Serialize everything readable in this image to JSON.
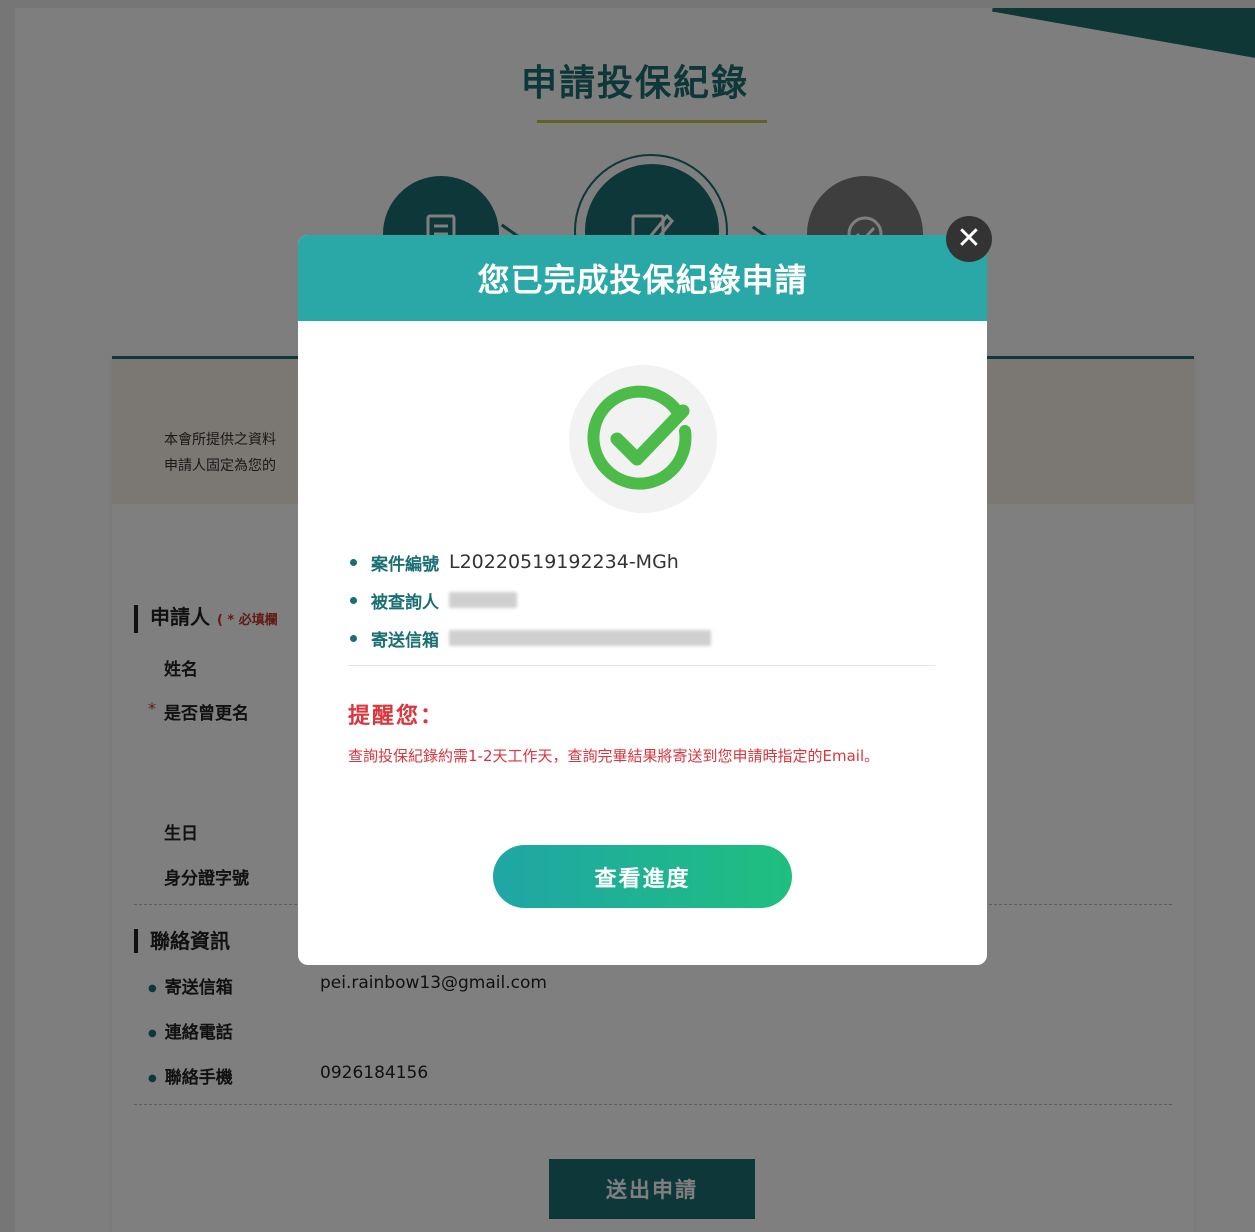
{
  "page": {
    "title": "申請投保紀錄"
  },
  "steps": [
    {
      "icon": "document-icon",
      "state": "done"
    },
    {
      "icon": "edit-icon",
      "state": "current"
    },
    {
      "icon": "check-circle-icon",
      "state": "pending"
    }
  ],
  "form": {
    "notice_lines": [
      "本會所提供之資料",
      "申請人固定為您的"
    ],
    "applicant_section": {
      "title": "申請人",
      "required_note": "( * 必填欄",
      "fields": [
        {
          "label": "姓名",
          "required": false
        },
        {
          "label": "是否曾更名",
          "required": true
        },
        {
          "label": "生日",
          "required": false
        },
        {
          "label": "身分證字號",
          "required": false
        }
      ]
    },
    "contact_section": {
      "title": "聯絡資訊",
      "fields": [
        {
          "label": "寄送信箱",
          "value": "pei.rainbow13@gmail.com"
        },
        {
          "label": "連絡電話",
          "value": ""
        },
        {
          "label": "聯絡手機",
          "value": "0926184156"
        }
      ]
    },
    "submit_label": "送出申請"
  },
  "modal": {
    "title": "您已完成投保紀錄申請",
    "close_symbol": "✕",
    "info": [
      {
        "label": "案件編號",
        "value": "L20220519192234-MGh"
      },
      {
        "label": "被查詢人",
        "value": ""
      },
      {
        "label": "寄送信箱",
        "value": ""
      }
    ],
    "reminder_title": "提醒您：",
    "reminder_text": "查詢投保紀錄約需1-2天工作天，查詢完畢結果將寄送到您申請時指定的Email。",
    "progress_button": "查看進度"
  },
  "colors": {
    "brand": "#1a6f73",
    "modal_header": "#2aa8a8",
    "success": "#4cbb4a",
    "alert": "#d9363e",
    "underline": "#c9c34a"
  }
}
